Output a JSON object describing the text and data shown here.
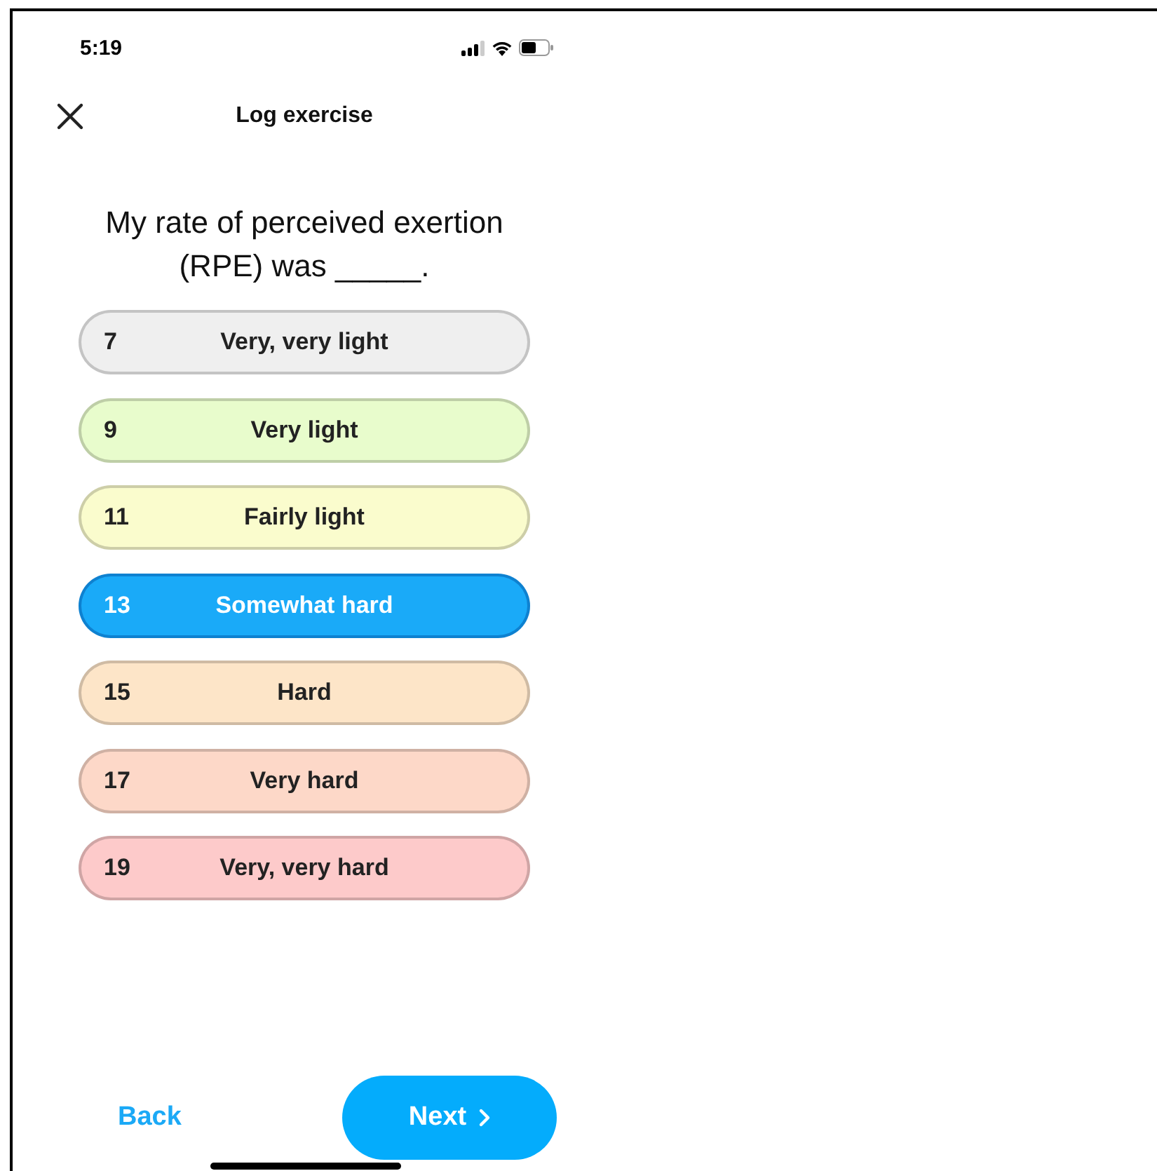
{
  "status_bar": {
    "time": "5:19"
  },
  "header": {
    "title": "Log exercise"
  },
  "question": "My rate of perceived exertion (RPE) was _____.",
  "options": [
    {
      "value": "7",
      "label": "Very, very light",
      "color": "#efefef",
      "selected": false
    },
    {
      "value": "9",
      "label": "Very light",
      "color": "#e8fccc",
      "selected": false
    },
    {
      "value": "11",
      "label": "Fairly light",
      "color": "#fafccd",
      "selected": false
    },
    {
      "value": "13",
      "label": "Somewhat hard",
      "color": "#1aaaf8",
      "selected": true
    },
    {
      "value": "15",
      "label": "Hard",
      "color": "#fde5c8",
      "selected": false
    },
    {
      "value": "17",
      "label": "Very hard",
      "color": "#fdd8c8",
      "selected": false
    },
    {
      "value": "19",
      "label": "Very, very hard",
      "color": "#fdcaca",
      "selected": false
    }
  ],
  "footer": {
    "back": "Back",
    "next": "Next"
  }
}
